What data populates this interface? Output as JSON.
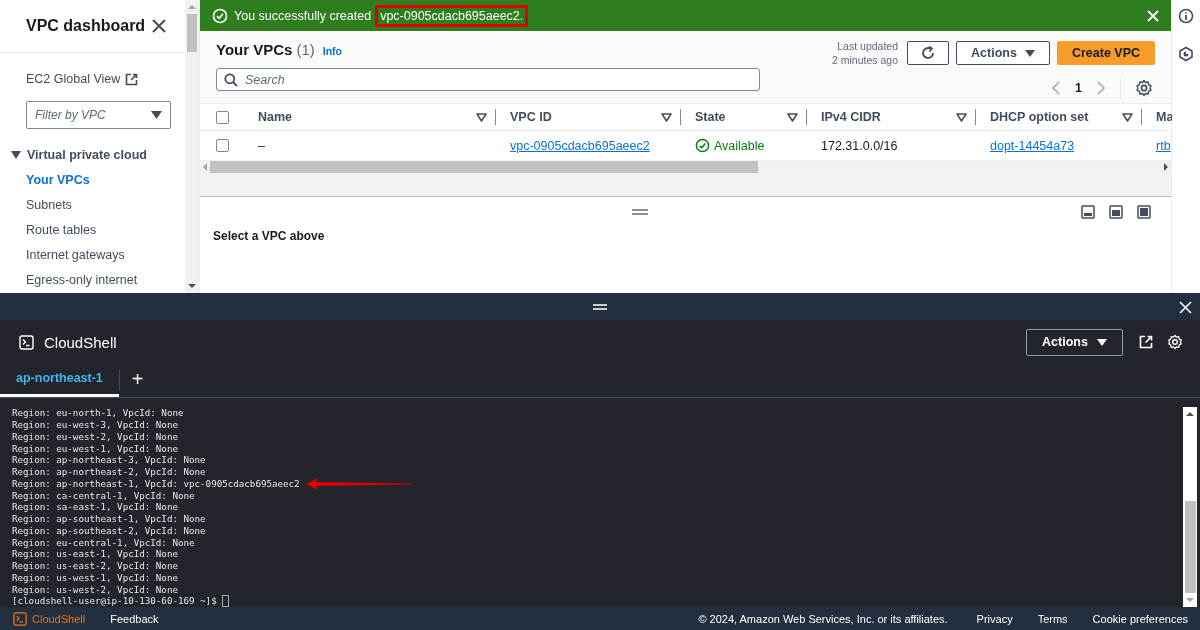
{
  "sidebar": {
    "title": "VPC dashboard",
    "global_view": "EC2 Global View",
    "filter": {
      "placeholder": "Filter by VPC"
    },
    "section": {
      "label": "Virtual private cloud",
      "expanded": true
    },
    "items": [
      {
        "label": "Your VPCs",
        "selected": true
      },
      {
        "label": "Subnets",
        "selected": false
      },
      {
        "label": "Route tables",
        "selected": false
      },
      {
        "label": "Internet gateways",
        "selected": false
      },
      {
        "label": "Egress-only internet",
        "selected": false
      }
    ]
  },
  "banner": {
    "message": "You successfully created",
    "highlight": "vpc-0905cdacb695aeec2."
  },
  "vpcs": {
    "title": "Your VPCs",
    "count": "(1)",
    "info": "Info",
    "last_updated": [
      "Last updated",
      "2 minutes ago"
    ],
    "actions": "Actions",
    "create": "Create VPC",
    "search": {
      "placeholder": "Search"
    },
    "page": "1",
    "all_selected": false,
    "columns": [
      "Name",
      "VPC ID",
      "State",
      "IPv4 CIDR",
      "DHCP option set",
      "Ma"
    ],
    "rows": [
      {
        "selected": false,
        "cells": [
          {
            "kind": "text",
            "text": "–"
          },
          {
            "kind": "link",
            "text": "vpc-0905cdacb695aeec2"
          },
          {
            "kind": "status",
            "text": "Available"
          },
          {
            "kind": "text",
            "text": "172.31.0.0/16"
          },
          {
            "kind": "link",
            "text": "dopt-14454a73"
          },
          {
            "kind": "link",
            "text": "rtb"
          }
        ]
      }
    ]
  },
  "details": {
    "empty": "Select a VPC above"
  },
  "cloudshell": {
    "title": "CloudShell",
    "actions": "Actions",
    "tabs": [
      {
        "label": "ap-northeast-1",
        "selected": true
      }
    ],
    "add_tab": "+",
    "lines": [
      {
        "text": "Region: eu-north-1, VpcId: None",
        "marked": false
      },
      {
        "text": "Region: eu-west-3, VpcId: None",
        "marked": false
      },
      {
        "text": "Region: eu-west-2, VpcId: None",
        "marked": false
      },
      {
        "text": "Region: eu-west-1, VpcId: None",
        "marked": false
      },
      {
        "text": "Region: ap-northeast-3, VpcId: None",
        "marked": false
      },
      {
        "text": "Region: ap-northeast-2, VpcId: None",
        "marked": false
      },
      {
        "text": "Region: ap-northeast-1, VpcId: vpc-0905cdacb695aeec2",
        "marked": true
      },
      {
        "text": "Region: ca-central-1, VpcId: None",
        "marked": false
      },
      {
        "text": "Region: sa-east-1, VpcId: None",
        "marked": false
      },
      {
        "text": "Region: ap-southeast-1, VpcId: None",
        "marked": false
      },
      {
        "text": "Region: ap-southeast-2, VpcId: None",
        "marked": false
      },
      {
        "text": "Region: eu-central-1, VpcId: None",
        "marked": false
      },
      {
        "text": "Region: us-east-1, VpcId: None",
        "marked": false
      },
      {
        "text": "Region: us-east-2, VpcId: None",
        "marked": false
      },
      {
        "text": "Region: us-west-1, VpcId: None",
        "marked": false
      },
      {
        "text": "Region: us-west-2, VpcId: None",
        "marked": false
      }
    ],
    "prompt": "[cloudshell-user@ip-10-130-60-169 ~]$"
  },
  "footer": {
    "brand": "CloudShell",
    "feedback": "Feedback",
    "copyright": "© 2024, Amazon Web Services, Inc. or its affiliates.",
    "links": [
      "Privacy",
      "Terms",
      "Cookie preferences"
    ]
  }
}
